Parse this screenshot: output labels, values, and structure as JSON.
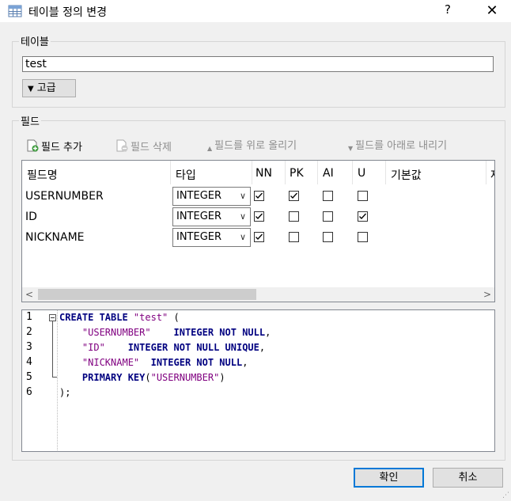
{
  "window": {
    "title": "테이블 정의 변경",
    "help_label": "?",
    "close_label": "✕"
  },
  "table_group": {
    "label": "테이블",
    "table_name": "test",
    "advanced_label": "고급"
  },
  "fields_group": {
    "label": "필드",
    "toolbar": {
      "add": "필드 추가",
      "delete": "필드 삭제",
      "move_up": "필드를 위로 올리기",
      "move_down": "필드를 아래로 내리기"
    },
    "columns": [
      "필드명",
      "타입",
      "NN",
      "PK",
      "AI",
      "U",
      "기본값",
      "제"
    ],
    "rows": [
      {
        "name": "USERNUMBER",
        "type": "INTEGER",
        "nn": true,
        "pk": true,
        "ai": false,
        "u": false
      },
      {
        "name": "ID",
        "type": "INTEGER",
        "nn": true,
        "pk": false,
        "ai": false,
        "u": true
      },
      {
        "name": "NICKNAME",
        "type": "INTEGER",
        "nn": true,
        "pk": false,
        "ai": false,
        "u": false
      }
    ]
  },
  "sql": {
    "line_numbers": [
      "1",
      "2",
      "3",
      "4",
      "5",
      "6"
    ],
    "lines": [
      [
        {
          "t": "CREATE TABLE ",
          "c": "kw"
        },
        {
          "t": "\"test\"",
          "c": "str"
        },
        {
          "t": " (",
          "c": "plain"
        }
      ],
      [
        {
          "t": "    ",
          "c": "plain"
        },
        {
          "t": "\"USERNUMBER\"",
          "c": "str"
        },
        {
          "t": "    INTEGER NOT NULL",
          "c": "kw"
        },
        {
          "t": ",",
          "c": "plain"
        }
      ],
      [
        {
          "t": "    ",
          "c": "plain"
        },
        {
          "t": "\"ID\"",
          "c": "str"
        },
        {
          "t": "    INTEGER NOT NULL UNIQUE",
          "c": "kw"
        },
        {
          "t": ",",
          "c": "plain"
        }
      ],
      [
        {
          "t": "    ",
          "c": "plain"
        },
        {
          "t": "\"NICKNAME\"",
          "c": "str"
        },
        {
          "t": "  INTEGER NOT NULL",
          "c": "kw"
        },
        {
          "t": ",",
          "c": "plain"
        }
      ],
      [
        {
          "t": "    PRIMARY KEY",
          "c": "kw"
        },
        {
          "t": "(",
          "c": "plain"
        },
        {
          "t": "\"USERNUMBER\"",
          "c": "str"
        },
        {
          "t": ")",
          "c": "plain"
        }
      ],
      [
        {
          "t": ");",
          "c": "plain"
        }
      ]
    ]
  },
  "buttons": {
    "ok": "확인",
    "cancel": "취소"
  },
  "colors": {
    "keyword": "#000080",
    "string": "#800080",
    "accent": "#0078d7"
  }
}
